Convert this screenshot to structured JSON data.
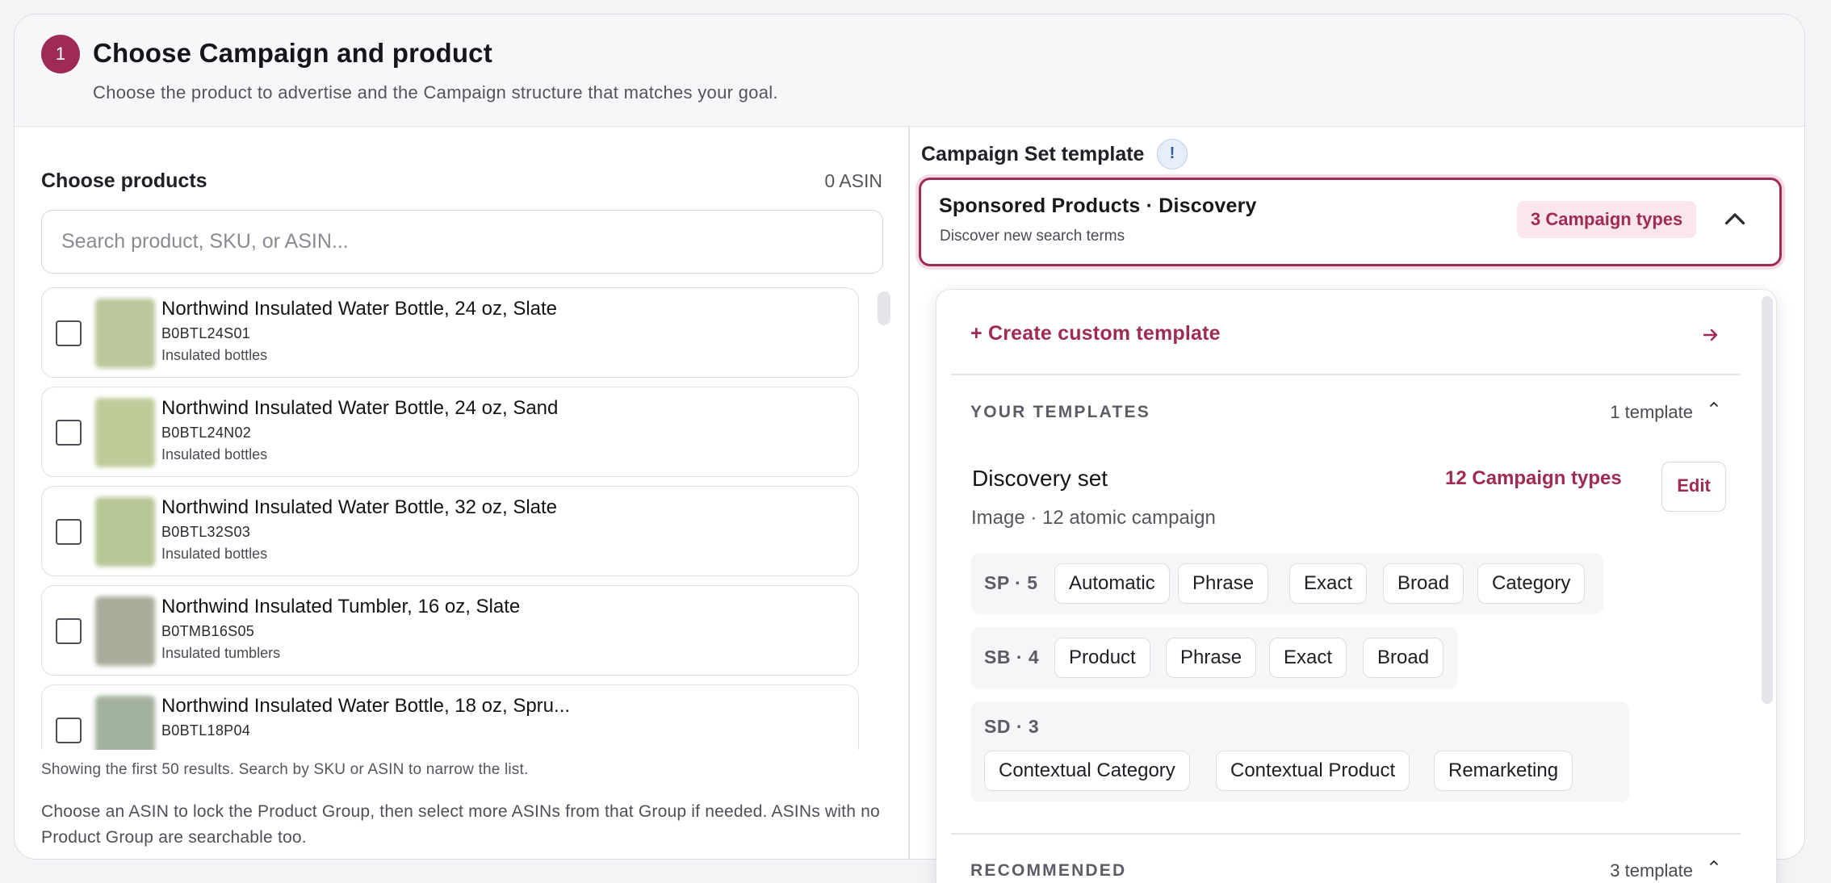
{
  "step": {
    "number": "1",
    "title": "Choose Campaign and product",
    "subtitle": "Choose the product to advertise and the Campaign structure that matches your goal."
  },
  "products": {
    "title": "Choose products",
    "asin_count": "0 ASIN",
    "search_placeholder": "Search product, SKU, or ASIN...",
    "items": [
      {
        "name": "Northwind Insulated Water Bottle, 24 oz, Slate",
        "sku": "B0BTL24S01",
        "category": "Insulated bottles",
        "thumb_color": "#b9c79a"
      },
      {
        "name": "Northwind Insulated Water Bottle, 24 oz, Sand",
        "sku": "B0BTL24N02",
        "category": "Insulated bottles",
        "thumb_color": "#bccb98"
      },
      {
        "name": "Northwind Insulated Water Bottle, 32 oz, Slate",
        "sku": "B0BTL32S03",
        "category": "Insulated bottles",
        "thumb_color": "#b6c695"
      },
      {
        "name": "Northwind Insulated Tumbler, 16 oz, Slate",
        "sku": "B0TMB16S05",
        "category": "Insulated tumblers",
        "thumb_color": "#a8ad9a"
      },
      {
        "name": "Northwind Insulated Water Bottle, 18 oz, Spru...",
        "sku": "B0BTL18P04",
        "category": "",
        "thumb_color": "#a2b29e"
      }
    ],
    "results_note": "Showing the first 50 results. Search by SKU or ASIN to narrow the list.",
    "help_text": "Choose an ASIN to lock the Product Group, then select more ASINs from that Group if needed. ASINs with no Product Group are searchable too."
  },
  "template": {
    "title": "Campaign Set template",
    "info_icon": "!",
    "selected": {
      "name": "Sponsored Products · Discovery",
      "description": "Discover new search terms",
      "types_badge": "3 Campaign types"
    },
    "dropdown": {
      "create_label": "+ Create custom template",
      "your_templates": {
        "label": "YOUR TEMPLATES",
        "count": "1 template",
        "item": {
          "name": "Discovery set",
          "types": "12 Campaign types",
          "edit_label": "Edit",
          "subtitle": "Image · 12 atomic campaign",
          "groups": [
            {
              "label": "SP · 5",
              "chips": [
                "Automatic",
                "Phrase",
                "Exact",
                "Broad",
                "Category"
              ]
            },
            {
              "label": "SB · 4",
              "chips": [
                "Product",
                "Phrase",
                "Exact",
                "Broad"
              ]
            },
            {
              "label": "SD · 3",
              "chips": [
                "Contextual Category",
                "Contextual Product",
                "Remarketing"
              ]
            }
          ]
        }
      },
      "recommended": {
        "label": "RECOMMENDED",
        "count": "3 template"
      }
    }
  },
  "colors": {
    "accent": "#9e2a55",
    "accent_soft": "#fbe6ee",
    "border": "#dcdce2"
  }
}
